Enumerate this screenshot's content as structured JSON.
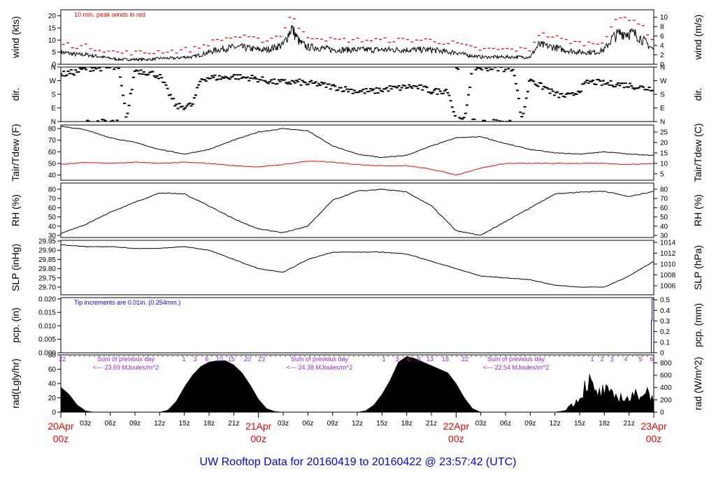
{
  "title": "UW Rooftop Data for 20160419  to  20160422 @ 23:57:42  (UTC)",
  "time_axis": {
    "hours_range": [
      0,
      72
    ],
    "hour_ticks": [
      "03z",
      "06z",
      "09z",
      "12z",
      "15z",
      "18z",
      "21z"
    ],
    "day_labels": [
      {
        "date": "20Apr",
        "hour": "00z"
      },
      {
        "date": "21Apr",
        "hour": "00z"
      },
      {
        "date": "22Apr",
        "hour": "00z"
      },
      {
        "date": "23Apr",
        "hour": "00z"
      }
    ]
  },
  "colors": {
    "primary": "#000000",
    "peak": "#ff0000",
    "dew": "#ff0000",
    "annotation_blue": "#0000ff",
    "annotation_purple": "#a020f0",
    "date_labels": "#ff0000",
    "title": "#0000ff"
  },
  "chart_data": [
    {
      "id": "wind",
      "type": "line",
      "ylabel": "wind (kts)",
      "ylabel_right": "wind (m/s)",
      "ylim": [
        0,
        22.5
      ],
      "yticks": [
        0,
        5,
        10,
        15,
        20
      ],
      "right_ticks": [
        0,
        2,
        4,
        6,
        8,
        10
      ],
      "right_to_left": {
        "mult": 1.944,
        "add": 0
      },
      "annotation": "10 min. peak winds in red",
      "step_hours": 1,
      "series": [
        {
          "name": "wind",
          "color": "#000000",
          "values": [
            5,
            4.5,
            4,
            4,
            3.5,
            3,
            2.5,
            2,
            2,
            2,
            2,
            2,
            2.5,
            2.5,
            2.5,
            3,
            3,
            4,
            5,
            6,
            6.5,
            7,
            7,
            6.5,
            6,
            6,
            7,
            8,
            15,
            9,
            7,
            7,
            6.5,
            6,
            6,
            6,
            6,
            6,
            6,
            6,
            6,
            6,
            6,
            6,
            6,
            6,
            5.5,
            5,
            5,
            4,
            3.5,
            3,
            3,
            3,
            3,
            3,
            3,
            3,
            8,
            7.5,
            7,
            6,
            5.5,
            5,
            5,
            5,
            6,
            11,
            13,
            13,
            12,
            9,
            6
          ]
        },
        {
          "name": "10 min peak",
          "color": "#ff0000",
          "derived_from": "wind"
        }
      ]
    },
    {
      "id": "dir",
      "type": "scatter",
      "ylabel": "dir.",
      "ylabel_right": "dir.",
      "ylim": [
        0,
        360
      ],
      "yticks": [
        0,
        90,
        180,
        270,
        360
      ],
      "ytick_labels": [
        "N",
        "E",
        "S",
        "W",
        "N"
      ],
      "step_hours": 1,
      "series": [
        {
          "name": "direction",
          "color": "#000000",
          "values": [
            310,
            320,
            330,
            350,
            355,
            355,
            355,
            350,
            20,
            340,
            330,
            320,
            300,
            200,
            100,
            100,
            110,
            280,
            290,
            290,
            290,
            300,
            290,
            290,
            280,
            270,
            260,
            260,
            260,
            260,
            250,
            250,
            240,
            230,
            220,
            210,
            200,
            200,
            200,
            210,
            220,
            220,
            230,
            230,
            220,
            200,
            200,
            210,
            5,
            10,
            355,
            355,
            355,
            355,
            350,
            350,
            10,
            290,
            240,
            220,
            180,
            170,
            170,
            210,
            260,
            260,
            250,
            250,
            245,
            240,
            230,
            220,
            220
          ]
        }
      ]
    },
    {
      "id": "temp",
      "type": "line",
      "ylabel": "Tair/Tdew (F)",
      "ylabel_right": "Tair/Tdew (C)",
      "ylim": [
        35.5,
        83
      ],
      "yticks": [
        40,
        50,
        60,
        70,
        80
      ],
      "right_ticks": [
        5,
        10,
        15,
        20,
        25
      ],
      "right_to_left": {
        "mult": 1.8,
        "add": 32
      },
      "step_hours": 3,
      "series": [
        {
          "name": "Tair",
          "color": "#000000",
          "values": [
            82,
            79,
            72,
            68,
            62,
            58,
            62,
            70,
            77,
            80,
            78,
            65,
            58,
            55,
            57,
            65,
            72,
            73,
            67,
            62,
            59,
            58,
            60,
            58,
            57
          ]
        },
        {
          "name": "Tdew",
          "color": "#ff0000",
          "values": [
            49,
            51,
            50,
            51,
            50,
            51,
            50,
            48,
            47,
            49,
            52,
            51,
            49,
            48,
            48,
            45,
            40,
            46,
            50,
            50,
            50,
            50,
            50,
            49,
            50
          ]
        }
      ]
    },
    {
      "id": "rh",
      "type": "line",
      "ylabel": "RH (%)",
      "ylabel_right": "RH (%)",
      "ylim": [
        27.7,
        86.8
      ],
      "yticks": [
        30,
        40,
        50,
        60,
        70,
        80
      ],
      "right_ticks": [
        30,
        40,
        50,
        60,
        70,
        80
      ],
      "right_to_left": {
        "mult": 1,
        "add": 0
      },
      "step_hours": 3,
      "series": [
        {
          "name": "RH",
          "color": "#000000",
          "values": [
            32,
            42,
            55,
            66,
            76,
            75,
            62,
            48,
            37,
            33,
            40,
            68,
            78,
            80,
            77,
            62,
            35,
            30,
            45,
            60,
            75,
            77,
            78,
            72,
            78
          ]
        }
      ]
    },
    {
      "id": "slp",
      "type": "line",
      "ylabel": "SLP (inHg)",
      "ylabel_right": "SLP (hPa)",
      "ylim": [
        29.658,
        29.954
      ],
      "yticks": [
        29.7,
        29.75,
        29.8,
        29.85,
        29.9,
        29.95
      ],
      "ytick_labels": [
        "29.70",
        "29.75",
        "29.80",
        "29.85",
        "29.90",
        "29.95"
      ],
      "right_ticks": [
        1006,
        1008,
        1010,
        1012,
        1014
      ],
      "right_to_left": {
        "mult": 0.02953,
        "add": 0
      },
      "step_hours": 3,
      "series": [
        {
          "name": "SLP",
          "color": "#000000",
          "values": [
            29.93,
            29.92,
            29.92,
            29.91,
            29.91,
            29.92,
            29.9,
            29.85,
            29.8,
            29.78,
            29.85,
            29.89,
            29.89,
            29.89,
            29.88,
            29.84,
            29.8,
            29.76,
            29.75,
            29.74,
            29.71,
            29.7,
            29.7,
            29.76,
            29.84
          ]
        }
      ]
    },
    {
      "id": "pcp",
      "type": "line",
      "ylabel": "pcp. (in)",
      "ylabel_right": "pcp. (mm)",
      "ylim": [
        0,
        0.0205
      ],
      "yticks": [
        0,
        0.005,
        0.01,
        0.015,
        0.02
      ],
      "ytick_labels": [
        "0.000",
        "0.005",
        "0.010",
        "0.015",
        "0.020"
      ],
      "right_ticks": [
        0,
        0.1,
        0.2,
        0.3,
        0.4,
        0.5
      ],
      "right_to_left": {
        "mult": 0.03937,
        "add": 0
      },
      "annotation": "Tip increments are 0.01in. (0.254mm.)",
      "series": [
        {
          "name": "cumulative precipitation",
          "color": "#0000ff",
          "points": [
            [
              0,
              0
            ],
            [
              71.6,
              0
            ],
            [
              71.7,
              0.012
            ],
            [
              71.8,
              0.02
            ],
            [
              72,
              0.02
            ]
          ]
        }
      ]
    },
    {
      "id": "rad",
      "type": "area",
      "ylabel": "rad(Lgly/hr)",
      "ylabel_right": "rad (W/m^2)",
      "ylim": [
        0,
        80
      ],
      "yticks": [
        0,
        20,
        40,
        60,
        80
      ],
      "right_ticks": [
        0,
        200,
        400,
        600,
        800
      ],
      "right_to_left": {
        "mult": 0.086,
        "add": 0
      },
      "step_hours": 1,
      "series": [
        {
          "name": "radiation",
          "color": "#000000",
          "values": [
            35,
            25,
            10,
            2,
            0,
            0,
            0,
            0,
            0,
            0,
            0,
            0,
            0,
            3,
            15,
            35,
            52,
            64,
            70,
            72,
            72,
            66,
            55,
            38,
            18,
            5,
            1,
            0,
            0,
            0,
            0,
            0,
            0,
            0,
            0,
            0,
            0,
            2,
            10,
            25,
            45,
            70,
            78,
            75,
            70,
            65,
            60,
            55,
            40,
            20,
            5,
            0,
            0,
            0,
            0,
            0,
            0,
            0,
            0,
            0,
            0,
            2,
            10,
            20,
            45,
            25,
            30,
            22,
            22,
            18,
            25,
            30,
            20
          ]
        }
      ],
      "daily_summaries": [
        {
          "line1": "Sum of previous day",
          "line2": "<--- 23.69 MJoules/m^2"
        },
        {
          "line1": "Sum of previous day",
          "line2": "<--- 24.38 MJoules/m^2"
        },
        {
          "line1": "Sum of previous day",
          "line2": "<--- 22.54 MJoules/m^2"
        }
      ],
      "hour_markers": [
        [
          "22"
        ],
        [
          "1",
          "3",
          "6",
          "10",
          "15",
          "20",
          "23"
        ],
        [
          "1",
          "3",
          "6",
          "9",
          "13",
          "18",
          "22"
        ],
        [
          "1",
          "2",
          "3",
          "4",
          "5",
          "6"
        ]
      ]
    }
  ]
}
